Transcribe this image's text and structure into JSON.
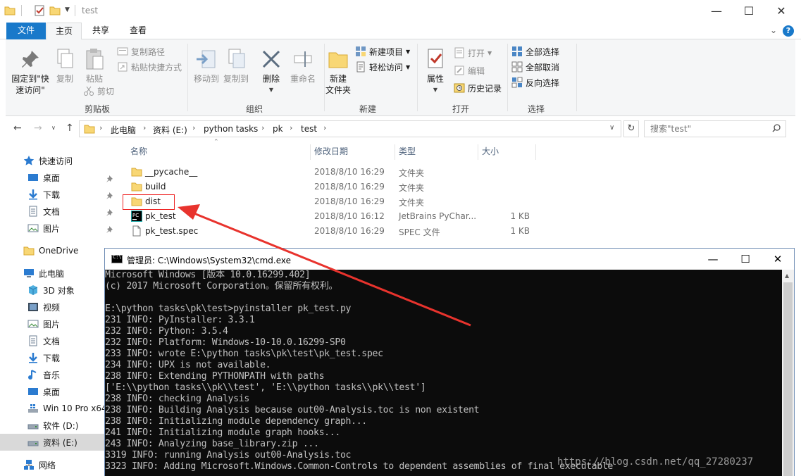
{
  "window": {
    "title": "test",
    "min": "—",
    "max": "☐",
    "close": "✕"
  },
  "tabs": {
    "file": "文件",
    "home": "主页",
    "share": "共享",
    "view": "查看"
  },
  "ribbon": {
    "clipboard": {
      "label": "剪贴板",
      "pin_line1": "固定到\"快",
      "pin_line2": "速访问\"",
      "copy": "复制",
      "paste": "粘贴",
      "copy_path": "复制路径",
      "paste_shortcut": "粘贴快捷方式",
      "cut": "剪切"
    },
    "organize": {
      "label": "组织",
      "move_to": "移动到",
      "copy_to": "复制到",
      "delete": "删除",
      "rename": "重命名"
    },
    "new": {
      "label": "新建",
      "new_folder_line1": "新建",
      "new_folder_line2": "文件夹",
      "new_item": "新建项目",
      "easy_access": "轻松访问"
    },
    "open": {
      "label": "打开",
      "properties": "属性",
      "open": "打开",
      "edit": "编辑",
      "history": "历史记录"
    },
    "select": {
      "label": "选择",
      "select_all": "全部选择",
      "select_none": "全部取消",
      "invert": "反向选择"
    }
  },
  "address": {
    "crumbs": [
      "此电脑",
      "资料 (E:)",
      "python tasks",
      "pk",
      "test"
    ],
    "search_placeholder": "搜索\"test\""
  },
  "nav": {
    "quick_access": "快速访问",
    "qa_items": [
      "桌面",
      "下载",
      "文档",
      "图片"
    ],
    "onedrive": "OneDrive",
    "this_pc": "此电脑",
    "pc_items": [
      "3D 对象",
      "视频",
      "图片",
      "文档",
      "下载",
      "音乐",
      "桌面",
      "Win 10 Pro x64",
      "软件 (D:)",
      "资料 (E:)"
    ],
    "network": "网络"
  },
  "files": {
    "columns": {
      "name": "名称",
      "date": "修改日期",
      "type": "类型",
      "size": "大小"
    },
    "rows": [
      {
        "name": "__pycache__",
        "date": "2018/8/10 16:29",
        "type": "文件夹",
        "size": "",
        "icon": "folder-icon"
      },
      {
        "name": "build",
        "date": "2018/8/10 16:29",
        "type": "文件夹",
        "size": "",
        "icon": "folder-icon"
      },
      {
        "name": "dist",
        "date": "2018/8/10 16:29",
        "type": "文件夹",
        "size": "",
        "icon": "folder-icon"
      },
      {
        "name": "pk_test",
        "date": "2018/8/10 16:12",
        "type": "JetBrains PyChar...",
        "size": "1 KB",
        "icon": "pycharm-icon"
      },
      {
        "name": "pk_test.spec",
        "date": "2018/8/10 16:29",
        "type": "SPEC 文件",
        "size": "1 KB",
        "icon": "file-icon"
      }
    ]
  },
  "cmd": {
    "title": "管理员: C:\\Windows\\System32\\cmd.exe",
    "lines": [
      "Microsoft Windows [版本 10.0.16299.402]",
      "(c) 2017 Microsoft Corporation。保留所有权利。",
      "",
      "E:\\python tasks\\pk\\test>pyinstaller pk_test.py",
      "231 INFO: PyInstaller: 3.3.1",
      "232 INFO: Python: 3.5.4",
      "232 INFO: Platform: Windows-10-10.0.16299-SP0",
      "233 INFO: wrote E:\\python tasks\\pk\\test\\pk_test.spec",
      "234 INFO: UPX is not available.",
      "238 INFO: Extending PYTHONPATH with paths",
      "['E:\\\\python tasks\\\\pk\\\\test', 'E:\\\\python tasks\\\\pk\\\\test']",
      "238 INFO: checking Analysis",
      "238 INFO: Building Analysis because out00-Analysis.toc is non existent",
      "238 INFO: Initializing module dependency graph...",
      "241 INFO: Initializing module graph hooks...",
      "243 INFO: Analyzing base_library.zip ...",
      "3319 INFO: running Analysis out00-Analysis.toc",
      "3323 INFO: Adding Microsoft.Windows.Common-Controls to dependent assemblies of final executable"
    ]
  },
  "watermark": "https://blog.csdn.net/qq_27280237",
  "colors": {
    "accent": "#1979ca",
    "folder": "#f8d775",
    "annotation": "#e8332d",
    "console_bg": "#0c0c0c"
  }
}
